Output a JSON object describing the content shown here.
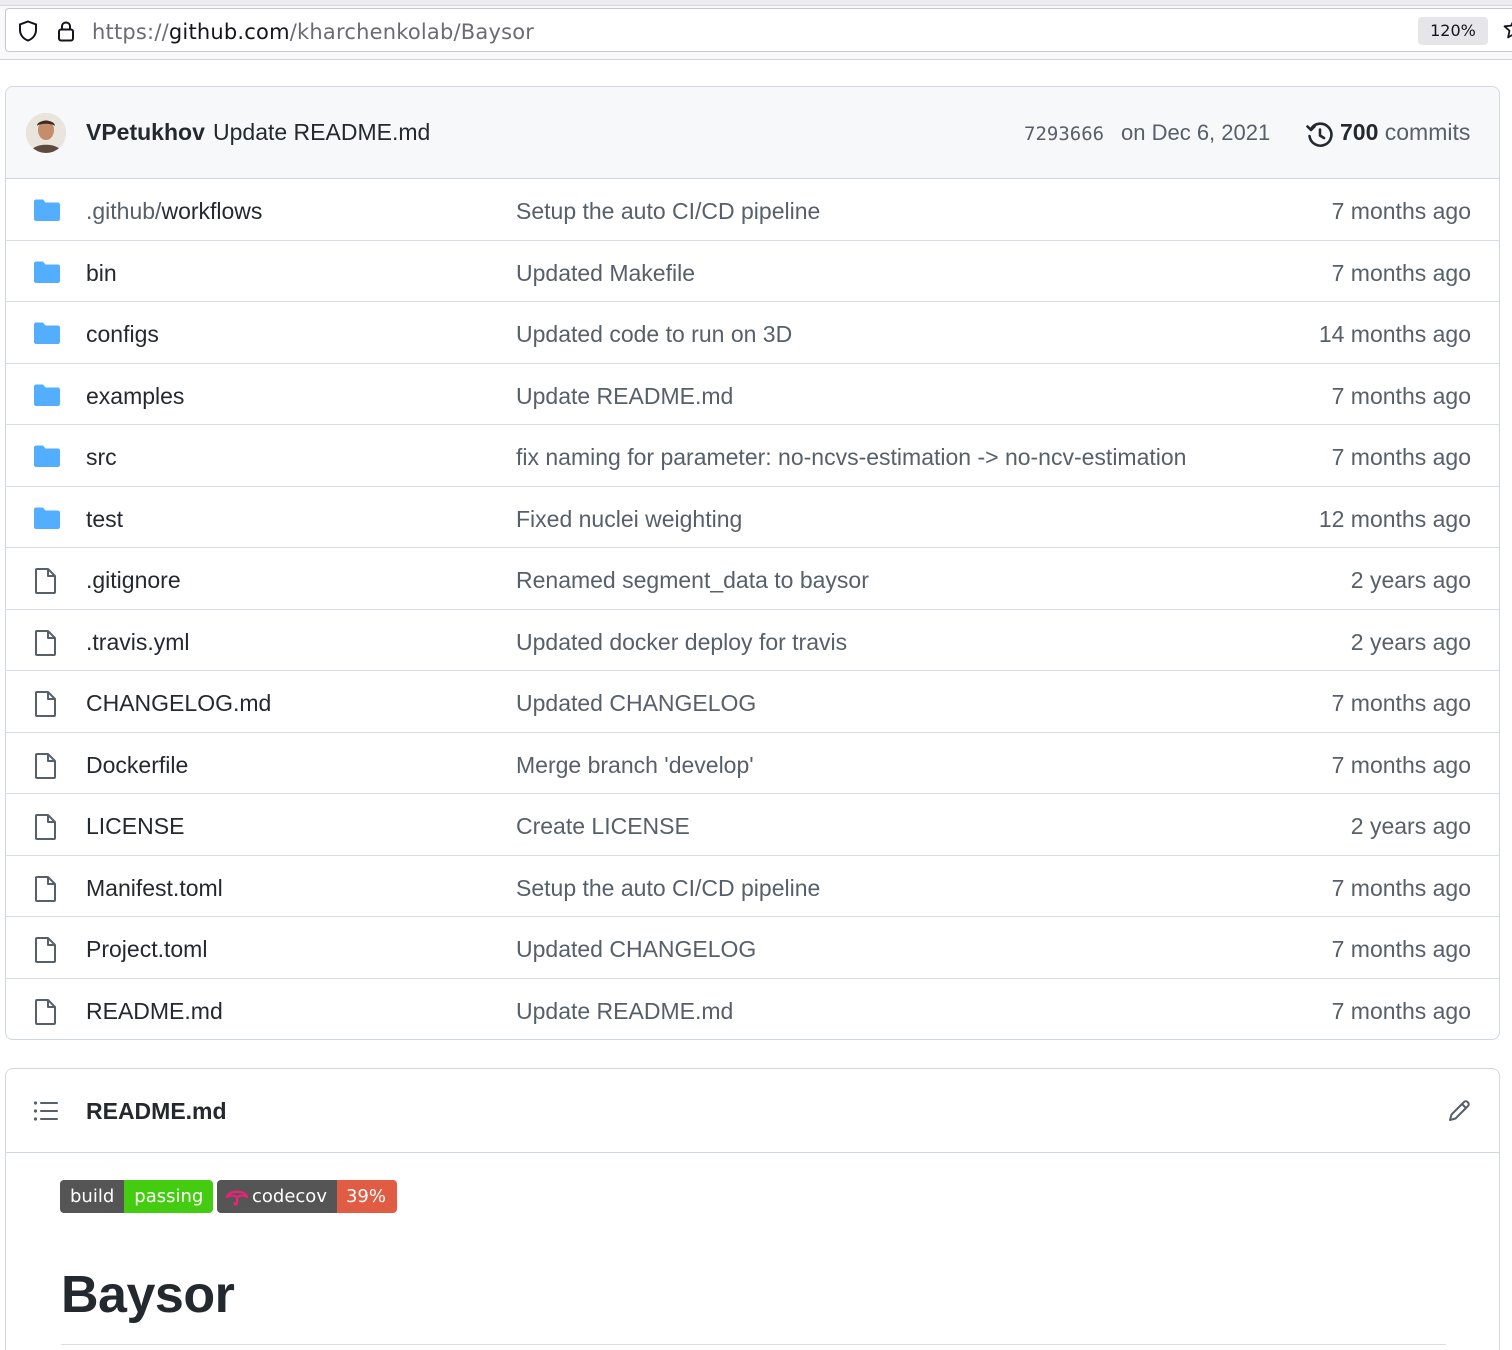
{
  "browser": {
    "url_scheme": "https://",
    "url_host": "github.com",
    "url_path": "/kharchenkolab/Baysor",
    "zoom": "120%"
  },
  "latest_commit": {
    "author": "VPetukhov",
    "message": "Update README.md",
    "sha": "7293666",
    "date": "on Dec 6, 2021",
    "commit_count": "700",
    "commit_label": "commits"
  },
  "files": [
    {
      "type": "dir",
      "prefix": ".github/",
      "name": "workflows",
      "message": "Setup the auto CI/CD pipeline",
      "age": "7 months ago"
    },
    {
      "type": "dir",
      "prefix": "",
      "name": "bin",
      "message": "Updated Makefile",
      "age": "7 months ago"
    },
    {
      "type": "dir",
      "prefix": "",
      "name": "configs",
      "message": "Updated code to run on 3D",
      "age": "14 months ago"
    },
    {
      "type": "dir",
      "prefix": "",
      "name": "examples",
      "message": "Update README.md",
      "age": "7 months ago"
    },
    {
      "type": "dir",
      "prefix": "",
      "name": "src",
      "message": "fix naming for parameter: no-ncvs-estimation -> no-ncv-estimation",
      "age": "7 months ago"
    },
    {
      "type": "dir",
      "prefix": "",
      "name": "test",
      "message": "Fixed nuclei weighting",
      "age": "12 months ago"
    },
    {
      "type": "file",
      "prefix": "",
      "name": ".gitignore",
      "message": "Renamed segment_data to baysor",
      "age": "2 years ago"
    },
    {
      "type": "file",
      "prefix": "",
      "name": ".travis.yml",
      "message": "Updated docker deploy for travis",
      "age": "2 years ago"
    },
    {
      "type": "file",
      "prefix": "",
      "name": "CHANGELOG.md",
      "message": "Updated CHANGELOG",
      "age": "7 months ago"
    },
    {
      "type": "file",
      "prefix": "",
      "name": "Dockerfile",
      "message": "Merge branch 'develop'",
      "age": "7 months ago"
    },
    {
      "type": "file",
      "prefix": "",
      "name": "LICENSE",
      "message": "Create LICENSE",
      "age": "2 years ago"
    },
    {
      "type": "file",
      "prefix": "",
      "name": "Manifest.toml",
      "message": "Setup the auto CI/CD pipeline",
      "age": "7 months ago"
    },
    {
      "type": "file",
      "prefix": "",
      "name": "Project.toml",
      "message": "Updated CHANGELOG",
      "age": "7 months ago"
    },
    {
      "type": "file",
      "prefix": "",
      "name": "README.md",
      "message": "Update README.md",
      "age": "7 months ago"
    }
  ],
  "readme": {
    "filename": "README.md",
    "badges": {
      "build_label": "build",
      "build_status": "passing",
      "codecov_label": "codecov",
      "codecov_value": "39%"
    },
    "heading": "Baysor"
  },
  "colors": {
    "folder": "#54aeff",
    "badge_green": "#44cc11",
    "badge_red": "#e05d44",
    "badge_gray": "#555555"
  }
}
